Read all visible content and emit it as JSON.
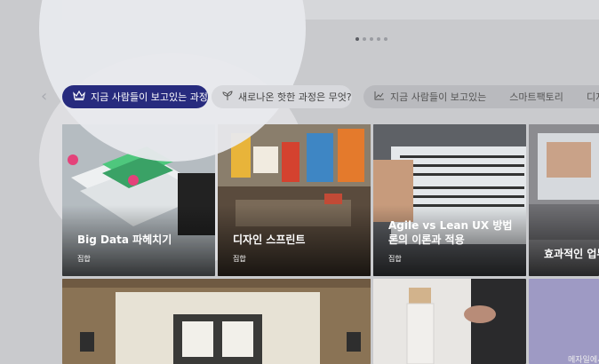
{
  "tabs": {
    "items": [
      {
        "label": "지금 사람들이 보고있는 과정",
        "icon": "crown-icon"
      },
      {
        "label": "새로나온 핫한 과정은 무엇?",
        "icon": "sprout-icon"
      },
      {
        "label": "지금 사람들이 보고있는",
        "icon": "trend-icon"
      },
      {
        "label": "스마트팩토리",
        "icon": ""
      },
      {
        "label": "디지",
        "icon": ""
      }
    ]
  },
  "cards": [
    {
      "title": "Big Data 파헤치기",
      "tag": "집합"
    },
    {
      "title": "디자인 스프린트",
      "tag": "집합"
    },
    {
      "title": "Agile vs Lean UX 방법론의 이론과 적용",
      "tag": "집합"
    },
    {
      "title": "효과적인 업무",
      "tag": ""
    }
  ],
  "partial_card_text": "메자일에서",
  "colors": {
    "active_tab": "#272b7e"
  }
}
